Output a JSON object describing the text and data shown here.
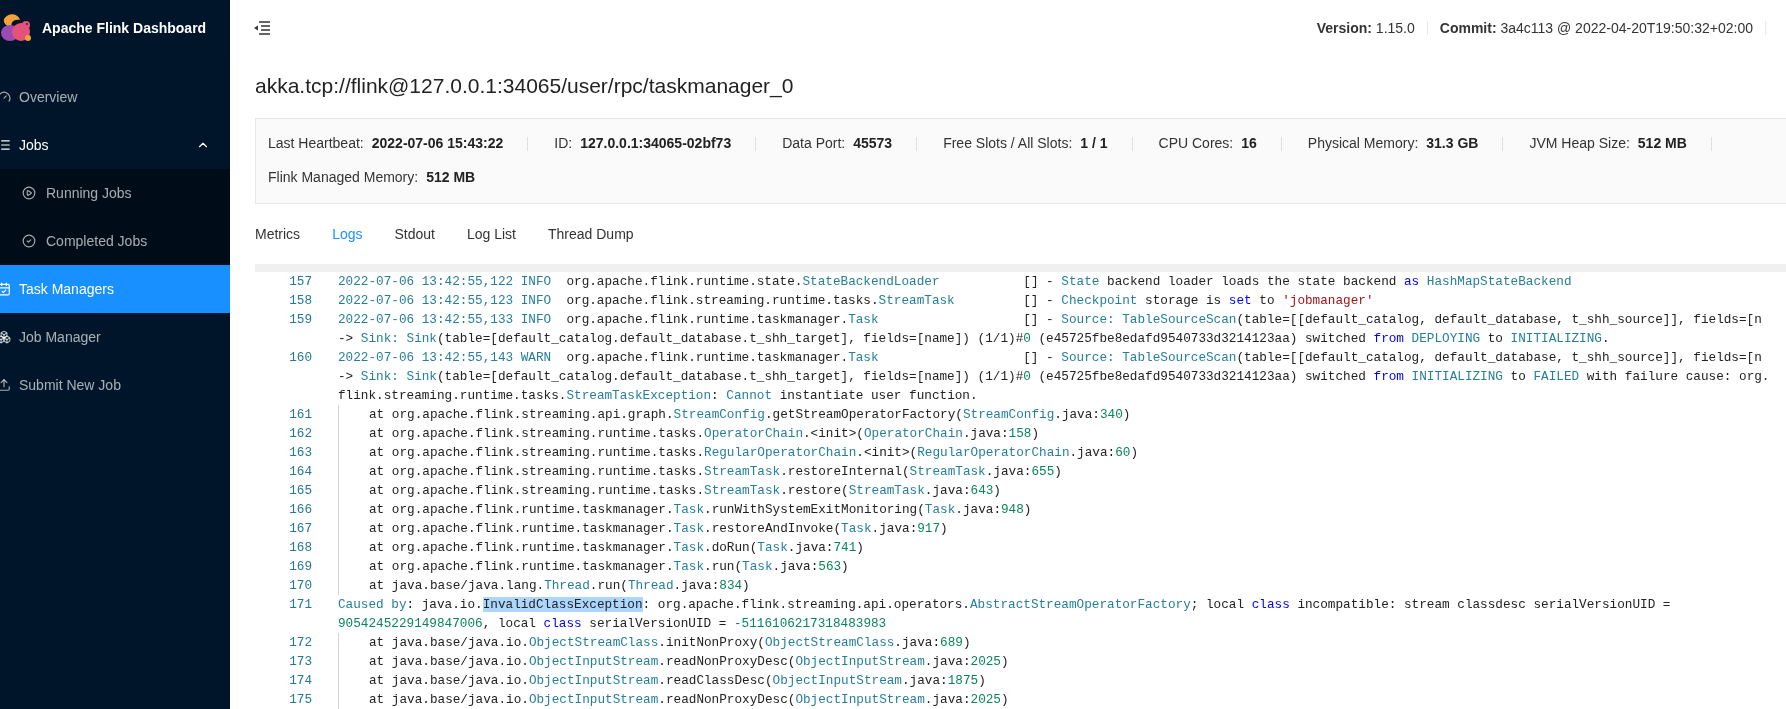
{
  "sidebar": {
    "brand": "Apache Flink Dashboard",
    "items": [
      {
        "label": "Overview",
        "selected": false
      },
      {
        "label": "Jobs",
        "selected": false,
        "expanded": true,
        "children": [
          {
            "label": "Running Jobs",
            "selected": false
          },
          {
            "label": "Completed Jobs",
            "selected": false
          }
        ]
      },
      {
        "label": "Task Managers",
        "selected": true
      },
      {
        "label": "Job Manager",
        "selected": false
      },
      {
        "label": "Submit New Job",
        "selected": false
      }
    ]
  },
  "header": {
    "version_label": "Version:",
    "version": "1.15.0",
    "commit_label": "Commit:",
    "commit": "3a4c113 @ 2022-04-20T19:50:32+02:00"
  },
  "title": "akka.tcp://flink@127.0.0.1:34065/user/rpc/taskmanager_0",
  "details": [
    {
      "label": "Last Heartbeat:",
      "value": "2022-07-06 15:43:22"
    },
    {
      "label": "ID:",
      "value": "127.0.0.1:34065-02bf73"
    },
    {
      "label": "Data Port:",
      "value": "45573"
    },
    {
      "label": "Free Slots / All Slots:",
      "value": "1 / 1"
    },
    {
      "label": "CPU Cores:",
      "value": "16"
    },
    {
      "label": "Physical Memory:",
      "value": "31.3 GB"
    },
    {
      "label": "JVM Heap Size:",
      "value": "512 MB"
    },
    {
      "label": "Flink Managed Memory:",
      "value": "512 MB"
    }
  ],
  "tabs": [
    {
      "label": "Metrics",
      "selected": false
    },
    {
      "label": "Logs",
      "selected": true
    },
    {
      "label": "Stdout",
      "selected": false
    },
    {
      "label": "Log List",
      "selected": false
    },
    {
      "label": "Thread Dump",
      "selected": false
    }
  ],
  "log": [
    {
      "number": "157",
      "kind": "entry",
      "lines": [
        [
          {
            "text": "2022-07-06 13:42:55,122 INFO",
            "kind": "type"
          },
          {
            "text": "  org.apache.flink.runtime.state.",
            "kind": "plain"
          },
          {
            "text": "StateBackendLoader",
            "kind": "type"
          },
          {
            "text": "           [] - ",
            "kind": "plain"
          },
          {
            "text": "State",
            "kind": "type"
          },
          {
            "text": " backend loader loads the state backend ",
            "kind": "plain"
          },
          {
            "text": "as ",
            "kind": "keyword"
          },
          {
            "text": "HashMapStateBackend",
            "kind": "type"
          }
        ]
      ]
    },
    {
      "number": "158",
      "kind": "entry",
      "lines": [
        [
          {
            "text": "2022-07-06 13:42:55,123 INFO",
            "kind": "type"
          },
          {
            "text": "  org.apache.flink.streaming.runtime.tasks.",
            "kind": "plain"
          },
          {
            "text": "StreamTask",
            "kind": "type"
          },
          {
            "text": "         [] - ",
            "kind": "plain"
          },
          {
            "text": "Checkpoint",
            "kind": "type"
          },
          {
            "text": " storage is ",
            "kind": "plain"
          },
          {
            "text": "set",
            "kind": "keyword"
          },
          {
            "text": " to ",
            "kind": "plain"
          },
          {
            "text": "'jobmanager'",
            "kind": "string"
          }
        ]
      ]
    },
    {
      "number": "159",
      "kind": "entry",
      "lines": [
        [
          {
            "text": "2022-07-06 13:42:55,133 INFO",
            "kind": "type"
          },
          {
            "text": "  org.apache.flink.runtime.taskmanager.",
            "kind": "plain"
          },
          {
            "text": "Task",
            "kind": "type"
          },
          {
            "text": "                   [] - ",
            "kind": "plain"
          },
          {
            "text": "Source: ",
            "kind": "type"
          },
          {
            "text": "TableSourceScan",
            "kind": "type"
          },
          {
            "text": "(table=[[default_catalog, default_database, t_shh_source]], fields=[n",
            "kind": "plain"
          }
        ],
        [
          {
            "text": "-> ",
            "kind": "plain"
          },
          {
            "text": "Sink: ",
            "kind": "type"
          },
          {
            "text": "Sink",
            "kind": "type"
          },
          {
            "text": "(table=[default_catalog.default_database.t_shh_target], fields=[name]) (1/1)#",
            "kind": "plain"
          },
          {
            "text": "0",
            "kind": "number"
          },
          {
            "text": " (e45725fbe8edafd9540733d3214123aa) switched ",
            "kind": "plain"
          },
          {
            "text": "from ",
            "kind": "keyword"
          },
          {
            "text": "DEPLOYING",
            "kind": "type"
          },
          {
            "text": " to ",
            "kind": "plain"
          },
          {
            "text": "INITIALIZING",
            "kind": "type"
          },
          {
            "text": ".",
            "kind": "plain"
          }
        ]
      ]
    },
    {
      "number": "160",
      "kind": "entry",
      "lines": [
        [
          {
            "text": "2022-07-06 13:42:55,143 WARN",
            "kind": "type"
          },
          {
            "text": "  org.apache.flink.runtime.taskmanager.",
            "kind": "plain"
          },
          {
            "text": "Task",
            "kind": "type"
          },
          {
            "text": "                   [] - ",
            "kind": "plain"
          },
          {
            "text": "Source: ",
            "kind": "type"
          },
          {
            "text": "TableSourceScan",
            "kind": "type"
          },
          {
            "text": "(table=[[default_catalog, default_database, t_shh_source]], fields=[n",
            "kind": "plain"
          }
        ],
        [
          {
            "text": "-> ",
            "kind": "plain"
          },
          {
            "text": "Sink: ",
            "kind": "type"
          },
          {
            "text": "Sink",
            "kind": "type"
          },
          {
            "text": "(table=[default_catalog.default_database.t_shh_target], fields=[name]) (1/1)#",
            "kind": "plain"
          },
          {
            "text": "0",
            "kind": "number"
          },
          {
            "text": " (e45725fbe8edafd9540733d3214123aa) switched ",
            "kind": "plain"
          },
          {
            "text": "from ",
            "kind": "keyword"
          },
          {
            "text": "INITIALIZING",
            "kind": "type"
          },
          {
            "text": " to ",
            "kind": "plain"
          },
          {
            "text": "FAILED",
            "kind": "type"
          },
          {
            "text": " with failure cause: org.",
            "kind": "plain"
          }
        ],
        [
          {
            "text": "flink.streaming.runtime.tasks.",
            "kind": "plain"
          },
          {
            "text": "StreamTaskException",
            "kind": "type"
          },
          {
            "text": ": ",
            "kind": "plain"
          },
          {
            "text": "Cannot",
            "kind": "type"
          },
          {
            "text": " instantiate user function.",
            "kind": "plain"
          }
        ]
      ]
    },
    {
      "number": "161",
      "kind": "frame",
      "lines": [
        [
          {
            "text": "at org.apache.flink.streaming.api.graph.",
            "kind": "plain"
          },
          {
            "text": "StreamConfig",
            "kind": "type"
          },
          {
            "text": ".getStreamOperatorFactory(",
            "kind": "plain"
          },
          {
            "text": "StreamConfig",
            "kind": "type"
          },
          {
            "text": ".java:",
            "kind": "plain"
          },
          {
            "text": "340",
            "kind": "number"
          },
          {
            "text": ")",
            "kind": "plain"
          }
        ]
      ]
    },
    {
      "number": "162",
      "kind": "frame",
      "lines": [
        [
          {
            "text": "at org.apache.flink.streaming.runtime.tasks.",
            "kind": "plain"
          },
          {
            "text": "OperatorChain",
            "kind": "type"
          },
          {
            "text": ".<init>(",
            "kind": "plain"
          },
          {
            "text": "OperatorChain",
            "kind": "type"
          },
          {
            "text": ".java:",
            "kind": "plain"
          },
          {
            "text": "158",
            "kind": "number"
          },
          {
            "text": ")",
            "kind": "plain"
          }
        ]
      ]
    },
    {
      "number": "163",
      "kind": "frame",
      "lines": [
        [
          {
            "text": "at org.apache.flink.streaming.runtime.tasks.",
            "kind": "plain"
          },
          {
            "text": "RegularOperatorChain",
            "kind": "type"
          },
          {
            "text": ".<init>(",
            "kind": "plain"
          },
          {
            "text": "RegularOperatorChain",
            "kind": "type"
          },
          {
            "text": ".java:",
            "kind": "plain"
          },
          {
            "text": "60",
            "kind": "number"
          },
          {
            "text": ")",
            "kind": "plain"
          }
        ]
      ]
    },
    {
      "number": "164",
      "kind": "frame",
      "lines": [
        [
          {
            "text": "at org.apache.flink.streaming.runtime.tasks.",
            "kind": "plain"
          },
          {
            "text": "StreamTask",
            "kind": "type"
          },
          {
            "text": ".restoreInternal(",
            "kind": "plain"
          },
          {
            "text": "StreamTask",
            "kind": "type"
          },
          {
            "text": ".java:",
            "kind": "plain"
          },
          {
            "text": "655",
            "kind": "number"
          },
          {
            "text": ")",
            "kind": "plain"
          }
        ]
      ]
    },
    {
      "number": "165",
      "kind": "frame",
      "lines": [
        [
          {
            "text": "at org.apache.flink.streaming.runtime.tasks.",
            "kind": "plain"
          },
          {
            "text": "StreamTask",
            "kind": "type"
          },
          {
            "text": ".restore(",
            "kind": "plain"
          },
          {
            "text": "StreamTask",
            "kind": "type"
          },
          {
            "text": ".java:",
            "kind": "plain"
          },
          {
            "text": "643",
            "kind": "number"
          },
          {
            "text": ")",
            "kind": "plain"
          }
        ]
      ]
    },
    {
      "number": "166",
      "kind": "frame",
      "lines": [
        [
          {
            "text": "at org.apache.flink.runtime.taskmanager.",
            "kind": "plain"
          },
          {
            "text": "Task",
            "kind": "type"
          },
          {
            "text": ".runWithSystemExitMonitoring(",
            "kind": "plain"
          },
          {
            "text": "Task",
            "kind": "type"
          },
          {
            "text": ".java:",
            "kind": "plain"
          },
          {
            "text": "948",
            "kind": "number"
          },
          {
            "text": ")",
            "kind": "plain"
          }
        ]
      ]
    },
    {
      "number": "167",
      "kind": "frame",
      "lines": [
        [
          {
            "text": "at org.apache.flink.runtime.taskmanager.",
            "kind": "plain"
          },
          {
            "text": "Task",
            "kind": "type"
          },
          {
            "text": ".restoreAndInvoke(",
            "kind": "plain"
          },
          {
            "text": "Task",
            "kind": "type"
          },
          {
            "text": ".java:",
            "kind": "plain"
          },
          {
            "text": "917",
            "kind": "number"
          },
          {
            "text": ")",
            "kind": "plain"
          }
        ]
      ]
    },
    {
      "number": "168",
      "kind": "frame",
      "lines": [
        [
          {
            "text": "at org.apache.flink.runtime.taskmanager.",
            "kind": "plain"
          },
          {
            "text": "Task",
            "kind": "type"
          },
          {
            "text": ".doRun(",
            "kind": "plain"
          },
          {
            "text": "Task",
            "kind": "type"
          },
          {
            "text": ".java:",
            "kind": "plain"
          },
          {
            "text": "741",
            "kind": "number"
          },
          {
            "text": ")",
            "kind": "plain"
          }
        ]
      ]
    },
    {
      "number": "169",
      "kind": "frame",
      "lines": [
        [
          {
            "text": "at org.apache.flink.runtime.taskmanager.",
            "kind": "plain"
          },
          {
            "text": "Task",
            "kind": "type"
          },
          {
            "text": ".run(",
            "kind": "plain"
          },
          {
            "text": "Task",
            "kind": "type"
          },
          {
            "text": ".java:",
            "kind": "plain"
          },
          {
            "text": "563",
            "kind": "number"
          },
          {
            "text": ")",
            "kind": "plain"
          }
        ]
      ]
    },
    {
      "number": "170",
      "kind": "frame",
      "lines": [
        [
          {
            "text": "at java.base/java.lang.",
            "kind": "plain"
          },
          {
            "text": "Thread",
            "kind": "type"
          },
          {
            "text": ".run(",
            "kind": "plain"
          },
          {
            "text": "Thread",
            "kind": "type"
          },
          {
            "text": ".java:",
            "kind": "plain"
          },
          {
            "text": "834",
            "kind": "number"
          },
          {
            "text": ")",
            "kind": "plain"
          }
        ]
      ]
    },
    {
      "number": "171",
      "kind": "entry",
      "lines": [
        [
          {
            "text": "Caused by",
            "kind": "type"
          },
          {
            "text": ": java.io.",
            "kind": "plain"
          },
          {
            "text": "InvalidClassException",
            "kind": "selected"
          },
          {
            "text": ": org.apache.flink.streaming.api.operators.",
            "kind": "plain"
          },
          {
            "text": "AbstractStreamOperatorFactory",
            "kind": "type"
          },
          {
            "text": "; local ",
            "kind": "plain"
          },
          {
            "text": "class",
            "kind": "keyword"
          },
          {
            "text": " incompatible: stream classdesc serialVersionUID =",
            "kind": "plain"
          }
        ],
        [
          {
            "text": "9054245229149847006",
            "kind": "number"
          },
          {
            "text": ", local ",
            "kind": "plain"
          },
          {
            "text": "class",
            "kind": "keyword"
          },
          {
            "text": " serialVersionUID = ",
            "kind": "plain"
          },
          {
            "text": "-5116106217318483983",
            "kind": "number"
          }
        ]
      ]
    },
    {
      "number": "172",
      "kind": "frame",
      "lines": [
        [
          {
            "text": "at java.base/java.io.",
            "kind": "plain"
          },
          {
            "text": "ObjectStreamClass",
            "kind": "type"
          },
          {
            "text": ".initNonProxy(",
            "kind": "plain"
          },
          {
            "text": "ObjectStreamClass",
            "kind": "type"
          },
          {
            "text": ".java:",
            "kind": "plain"
          },
          {
            "text": "689",
            "kind": "number"
          },
          {
            "text": ")",
            "kind": "plain"
          }
        ]
      ]
    },
    {
      "number": "173",
      "kind": "frame",
      "lines": [
        [
          {
            "text": "at java.base/java.io.",
            "kind": "plain"
          },
          {
            "text": "ObjectInputStream",
            "kind": "type"
          },
          {
            "text": ".readNonProxyDesc(",
            "kind": "plain"
          },
          {
            "text": "ObjectInputStream",
            "kind": "type"
          },
          {
            "text": ".java:",
            "kind": "plain"
          },
          {
            "text": "2025",
            "kind": "number"
          },
          {
            "text": ")",
            "kind": "plain"
          }
        ]
      ]
    },
    {
      "number": "174",
      "kind": "frame",
      "lines": [
        [
          {
            "text": "at java.base/java.io.",
            "kind": "plain"
          },
          {
            "text": "ObjectInputStream",
            "kind": "type"
          },
          {
            "text": ".readClassDesc(",
            "kind": "plain"
          },
          {
            "text": "ObjectInputStream",
            "kind": "type"
          },
          {
            "text": ".java:",
            "kind": "plain"
          },
          {
            "text": "1875",
            "kind": "number"
          },
          {
            "text": ")",
            "kind": "plain"
          }
        ]
      ]
    },
    {
      "number": "175",
      "kind": "frame",
      "lines": [
        [
          {
            "text": "at java.base/java.io.",
            "kind": "plain"
          },
          {
            "text": "ObjectInputStream",
            "kind": "type"
          },
          {
            "text": ".readNonProxyDesc(",
            "kind": "plain"
          },
          {
            "text": "ObjectInputStream",
            "kind": "type"
          },
          {
            "text": ".java:",
            "kind": "plain"
          },
          {
            "text": "2025",
            "kind": "number"
          },
          {
            "text": ")",
            "kind": "plain"
          }
        ]
      ]
    }
  ]
}
